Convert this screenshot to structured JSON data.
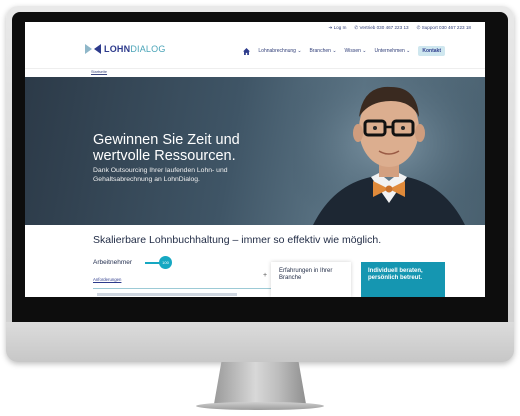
{
  "topbar": {
    "login": "➔ Log In",
    "sales": "✆ Vertrieb 030 467 223 13",
    "support": "✆ Support 030 467 223 18"
  },
  "brand": {
    "logo_strong": "LOHN",
    "logo_light": "DIALOG"
  },
  "nav": {
    "items": [
      "Lohnabrechnung ⌄",
      "Branchen ⌄",
      "Wissen ⌄",
      "Unternehmen ⌄"
    ],
    "contact": "Kontakt"
  },
  "breadcrumb": "Startseite",
  "hero": {
    "title": "Gewinnen Sie Zeit und wertvolle Ressourcen.",
    "subtitle": "Dank Outsourcing Ihrer laufenden Lohn- und Gehaltsabrechnung an LohnDialog."
  },
  "section": {
    "title": "Skalierbare Lohnbuchhaltung – immer so effektiv wie möglich.",
    "slider_label": "Arbeitnehmer",
    "slider_value": "100",
    "requirements_link": "Anforderungen",
    "expand_symbol": "+",
    "card_experience": "Erfahrungen in Ihrer Branche",
    "card_individual": "Individuell beraten, persönlich betreut."
  },
  "colors": {
    "brand_blue": "#2d3b8c",
    "accent_teal": "#16a8c2",
    "hero_bg": "#3f5566"
  }
}
